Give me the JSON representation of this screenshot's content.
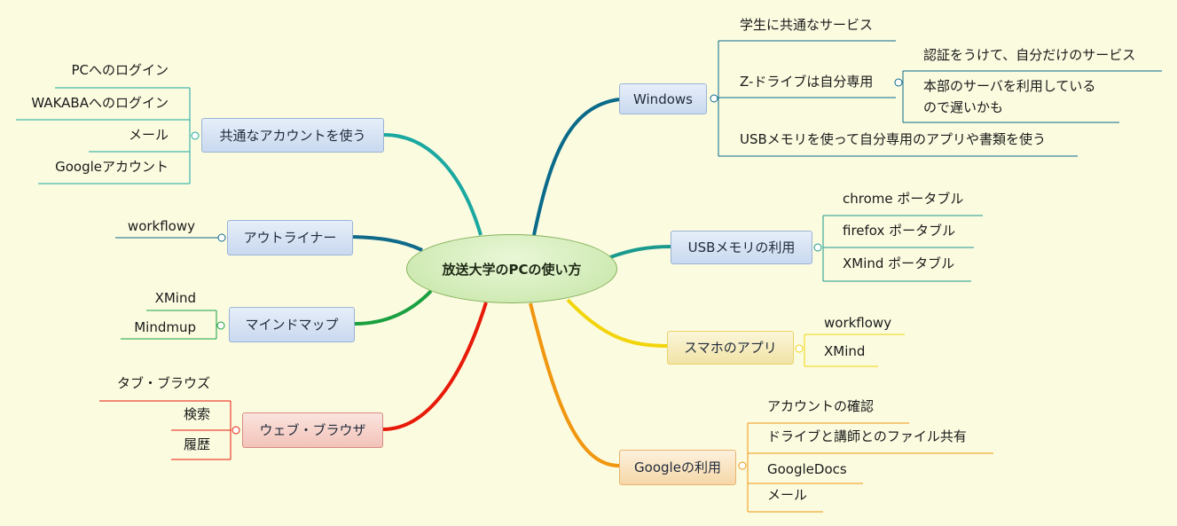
{
  "central": "放送大学のPCの使い方",
  "branches": {
    "windows": {
      "label": "Windows",
      "children": {
        "common_service": "学生に共通なサービス",
        "z_drive": "Z-ドライブは自分専用",
        "z_auth": "認証をうけて、自分だけのサービス",
        "z_slow_1": "本部のサーバを利用している",
        "z_slow_2": "ので遅いかも",
        "usb_use": "USBメモリを使って自分専用のアプリや書類を使う"
      }
    },
    "usb": {
      "label": "USBメモリの利用",
      "children": [
        "chrome ポータブル",
        "firefox ポータブル",
        "XMind ポータブル"
      ]
    },
    "smartphone": {
      "label": "スマホのアプリ",
      "children": [
        "workflowy",
        "XMind"
      ]
    },
    "google": {
      "label": "Googleの利用",
      "children": [
        "アカウントの確認",
        "ドライブと講師とのファイル共有",
        "GoogleDocs",
        "メール"
      ]
    },
    "account": {
      "label": "共通なアカウントを使う",
      "children": [
        "PCへのログイン",
        "WAKABAへのログイン",
        "メール",
        "Googleアカウント"
      ]
    },
    "outliner": {
      "label": "アウトライナー",
      "children": [
        "workflowy"
      ]
    },
    "mindmap": {
      "label": "マインドマップ",
      "children": [
        "XMind",
        "Mindmup"
      ]
    },
    "browser": {
      "label": "ウェブ・ブラウザ",
      "children": [
        "タブ・ブラウズ",
        "検索",
        "履歴"
      ]
    }
  },
  "colors": {
    "background": "#fbfbe0",
    "windows": "#0a6a8a",
    "usb": "#1a9a8e",
    "smartphone": "#f2d40a",
    "google": "#f0960f",
    "account": "#1aa8a0",
    "outliner": "#106a8a",
    "mindmap": "#1aa040",
    "browser": "#e81a0a"
  }
}
